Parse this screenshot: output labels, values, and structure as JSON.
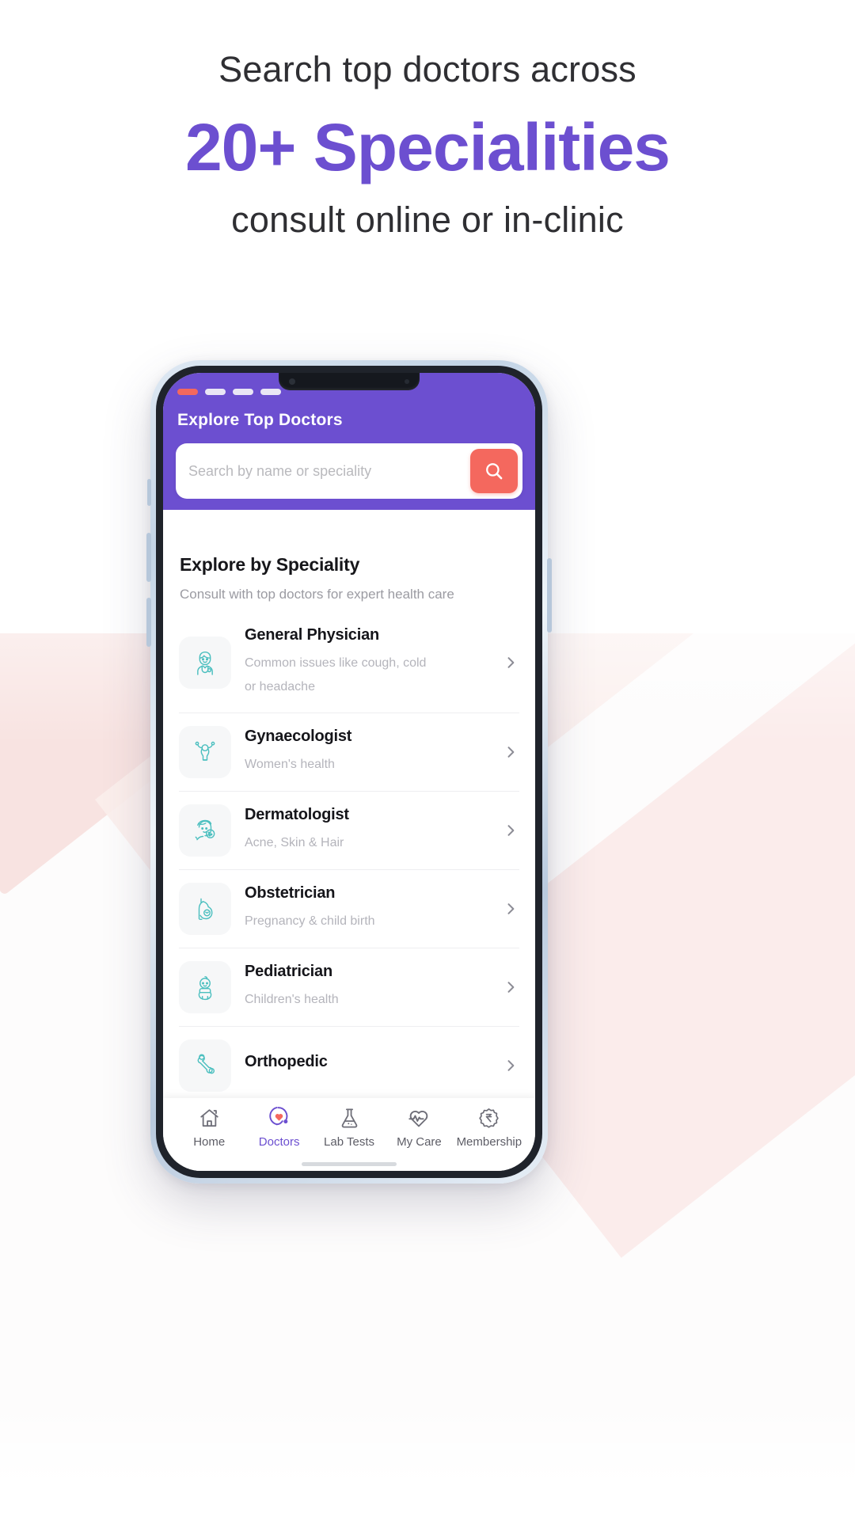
{
  "hero": {
    "line1": "Search top doctors across",
    "line2": "20+ Specialities",
    "line3": "consult online or in-clinic"
  },
  "colors": {
    "brand_purple": "#6c4fd0",
    "accent_coral": "#f4685e",
    "icon_teal": "#4bbfbf",
    "text_dark": "#16161a",
    "text_muted": "#b4b4bb"
  },
  "app": {
    "header": {
      "title": "Explore Top Doctors",
      "progress_dots": [
        {
          "state": "active"
        },
        {
          "state": "inactive"
        },
        {
          "state": "inactive"
        },
        {
          "state": "inactive"
        }
      ]
    },
    "search": {
      "placeholder": "Search by name or speciality",
      "value": "",
      "button_icon": "search-icon"
    },
    "section": {
      "title": "Explore by Speciality",
      "subtitle": "Consult with top doctors for expert health care"
    },
    "specialities": [
      {
        "name": "General Physician",
        "description": "Common issues like cough, cold or headache",
        "icon": "doctor-icon"
      },
      {
        "name": "Gynaecologist",
        "description": "Women's health",
        "icon": "uterus-icon"
      },
      {
        "name": "Dermatologist",
        "description": "Acne, Skin & Hair",
        "icon": "face-skin-icon"
      },
      {
        "name": "Obstetrician",
        "description": "Pregnancy & child birth",
        "icon": "pregnancy-icon"
      },
      {
        "name": "Pediatrician",
        "description": "Children's health",
        "icon": "baby-icon"
      },
      {
        "name": "Orthopedic",
        "description": "",
        "icon": "bone-icon"
      }
    ],
    "bottom_nav": [
      {
        "label": "Home",
        "icon": "home-icon",
        "active": false
      },
      {
        "label": "Doctors",
        "icon": "stethoscope-heart-icon",
        "active": true
      },
      {
        "label": "Lab Tests",
        "icon": "flask-icon",
        "active": false
      },
      {
        "label": "My Care",
        "icon": "heart-pulse-icon",
        "active": false
      },
      {
        "label": "Membership",
        "icon": "rupee-badge-icon",
        "active": false
      }
    ]
  }
}
